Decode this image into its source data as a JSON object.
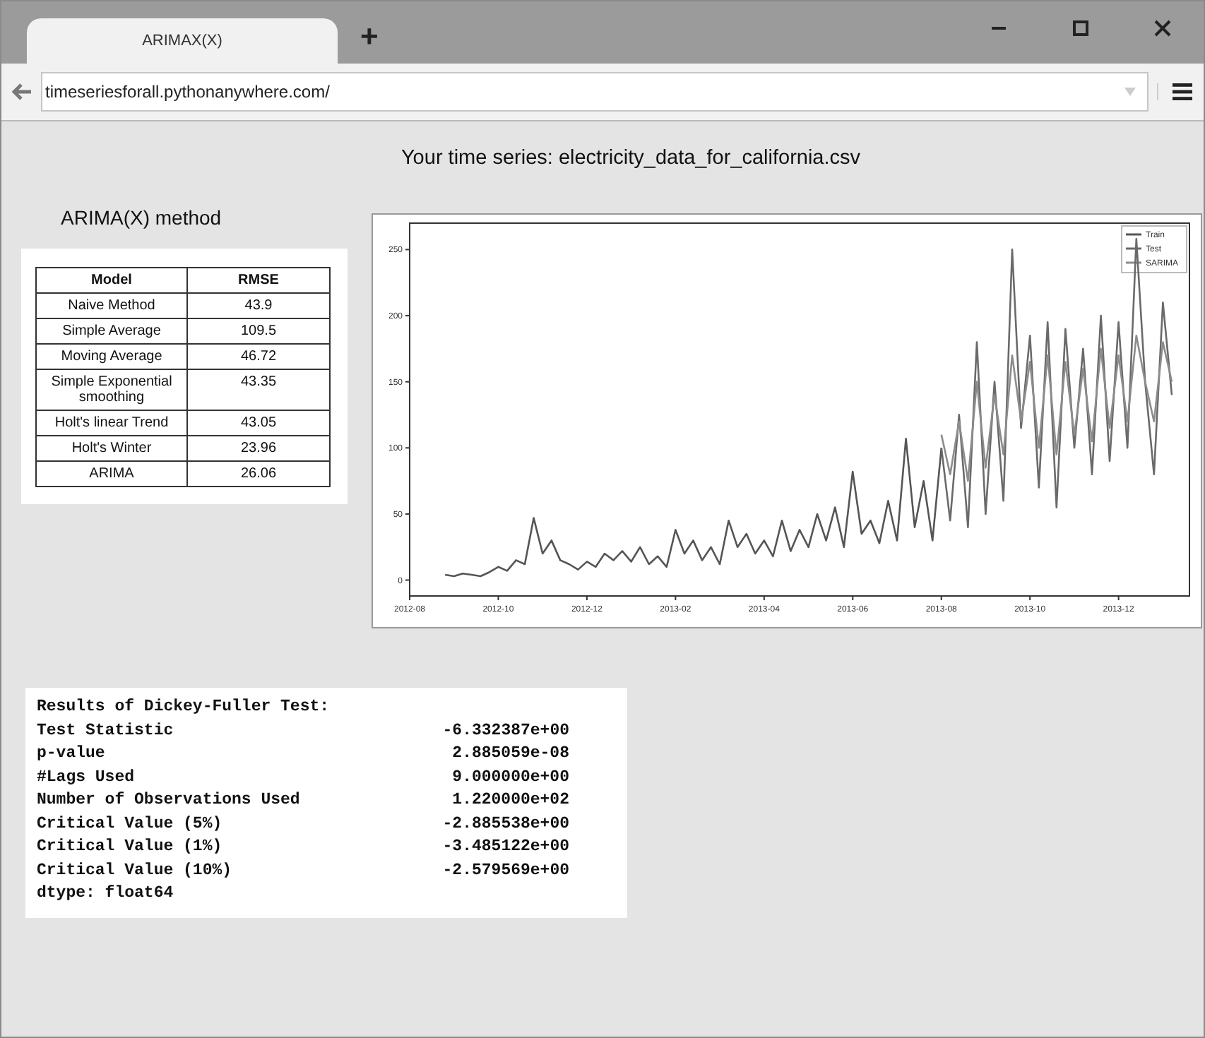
{
  "browser": {
    "tabs": [
      {
        "label": "ARIMAX(X)",
        "selected": true
      }
    ],
    "new_tab": "+",
    "address": "timeseriesforall.pythonanywhere.com/"
  },
  "page": {
    "title": "Your time series: electricity_data_for_california.csv",
    "method": {
      "heading": "ARIMA(X) method",
      "table": {
        "columns": [
          "Model",
          "RMSE"
        ],
        "rows": [
          [
            "Naive Method",
            "43.9"
          ],
          [
            "Simple Average",
            "109.5"
          ],
          [
            "Moving Average",
            "46.72"
          ],
          [
            "Simple Exponential smoothing",
            "43.35"
          ],
          [
            "Holt's linear Trend",
            "43.05"
          ],
          [
            "Holt's Winter",
            "23.96"
          ],
          [
            "ARIMA",
            "26.06"
          ]
        ]
      }
    },
    "chart_data": {
      "type": "line",
      "legend": "upper right",
      "ylim": [
        -12,
        270
      ],
      "yticks": [
        0,
        50,
        100,
        150,
        200,
        250
      ],
      "categories": [
        "2012-08",
        null,
        null,
        null,
        null,
        null,
        null,
        null,
        null,
        null,
        "2012-10",
        null,
        null,
        null,
        null,
        null,
        null,
        null,
        null,
        null,
        "2012-12",
        null,
        null,
        null,
        null,
        null,
        null,
        null,
        null,
        null,
        "2013-02",
        null,
        null,
        null,
        null,
        null,
        null,
        null,
        null,
        null,
        "2013-04",
        null,
        null,
        null,
        null,
        null,
        null,
        null,
        null,
        null,
        "2013-06",
        null,
        null,
        null,
        null,
        null,
        null,
        null,
        null,
        null,
        "2013-08",
        null,
        null,
        null,
        null,
        null,
        null,
        null,
        null,
        null,
        "2013-10",
        null,
        null,
        null,
        null,
        null,
        null,
        null,
        null,
        null,
        "2013-12",
        null,
        null,
        null,
        null,
        null,
        null
      ],
      "series": [
        {
          "name": "Train",
          "color": "#555555",
          "values": [
            null,
            null,
            null,
            null,
            4,
            3,
            5,
            4,
            3,
            6,
            10,
            7,
            15,
            12,
            47,
            20,
            30,
            15,
            12,
            8,
            14,
            10,
            20,
            15,
            22,
            14,
            25,
            12,
            18,
            10,
            38,
            20,
            30,
            15,
            25,
            12,
            45,
            25,
            35,
            20,
            30,
            18,
            45,
            22,
            38,
            25,
            50,
            30,
            55,
            25,
            82,
            35,
            45,
            28,
            60,
            30,
            107,
            40,
            75,
            30,
            100,
            null,
            null,
            null,
            null,
            null,
            null,
            null,
            null,
            null,
            null,
            null,
            null,
            null,
            null,
            null,
            null,
            null,
            null,
            null,
            null,
            null,
            null,
            null,
            null,
            null,
            null
          ]
        },
        {
          "name": "Test",
          "color": "#6a6a6a",
          "values": [
            null,
            null,
            null,
            null,
            null,
            null,
            null,
            null,
            null,
            null,
            null,
            null,
            null,
            null,
            null,
            null,
            null,
            null,
            null,
            null,
            null,
            null,
            null,
            null,
            null,
            null,
            null,
            null,
            null,
            null,
            null,
            null,
            null,
            null,
            null,
            null,
            null,
            null,
            null,
            null,
            null,
            null,
            null,
            null,
            null,
            null,
            null,
            null,
            null,
            null,
            null,
            null,
            null,
            null,
            null,
            null,
            null,
            null,
            null,
            null,
            100,
            45,
            125,
            40,
            180,
            50,
            150,
            60,
            250,
            115,
            185,
            70,
            195,
            55,
            190,
            100,
            175,
            80,
            200,
            90,
            195,
            100,
            258,
            150,
            80,
            210,
            140
          ]
        },
        {
          "name": "SARIMA",
          "color": "#8c8c8c",
          "values": [
            null,
            null,
            null,
            null,
            null,
            null,
            null,
            null,
            null,
            null,
            null,
            null,
            null,
            null,
            null,
            null,
            null,
            null,
            null,
            null,
            null,
            null,
            null,
            null,
            null,
            null,
            null,
            null,
            null,
            null,
            null,
            null,
            null,
            null,
            null,
            null,
            null,
            null,
            null,
            null,
            null,
            null,
            null,
            null,
            null,
            null,
            null,
            null,
            null,
            null,
            null,
            null,
            null,
            null,
            null,
            null,
            null,
            null,
            null,
            null,
            110,
            80,
            120,
            75,
            150,
            85,
            140,
            95,
            170,
            120,
            165,
            100,
            170,
            95,
            165,
            110,
            160,
            105,
            175,
            115,
            170,
            120,
            185,
            150,
            120,
            180,
            150
          ]
        }
      ]
    },
    "dickey_fuller": {
      "heading": "Results of Dickey-Fuller Test:",
      "rows": [
        [
          "Test Statistic",
          "-6.332387e+00"
        ],
        [
          "p-value",
          "2.885059e-08"
        ],
        [
          "#Lags Used",
          "9.000000e+00"
        ],
        [
          "Number of Observations Used",
          "1.220000e+02"
        ],
        [
          "Critical Value (5%)",
          "-2.885538e+00"
        ],
        [
          "Critical Value (1%)",
          "-3.485122e+00"
        ],
        [
          "Critical Value (10%)",
          "-2.579569e+00"
        ]
      ],
      "footer": "dtype: float64"
    }
  }
}
